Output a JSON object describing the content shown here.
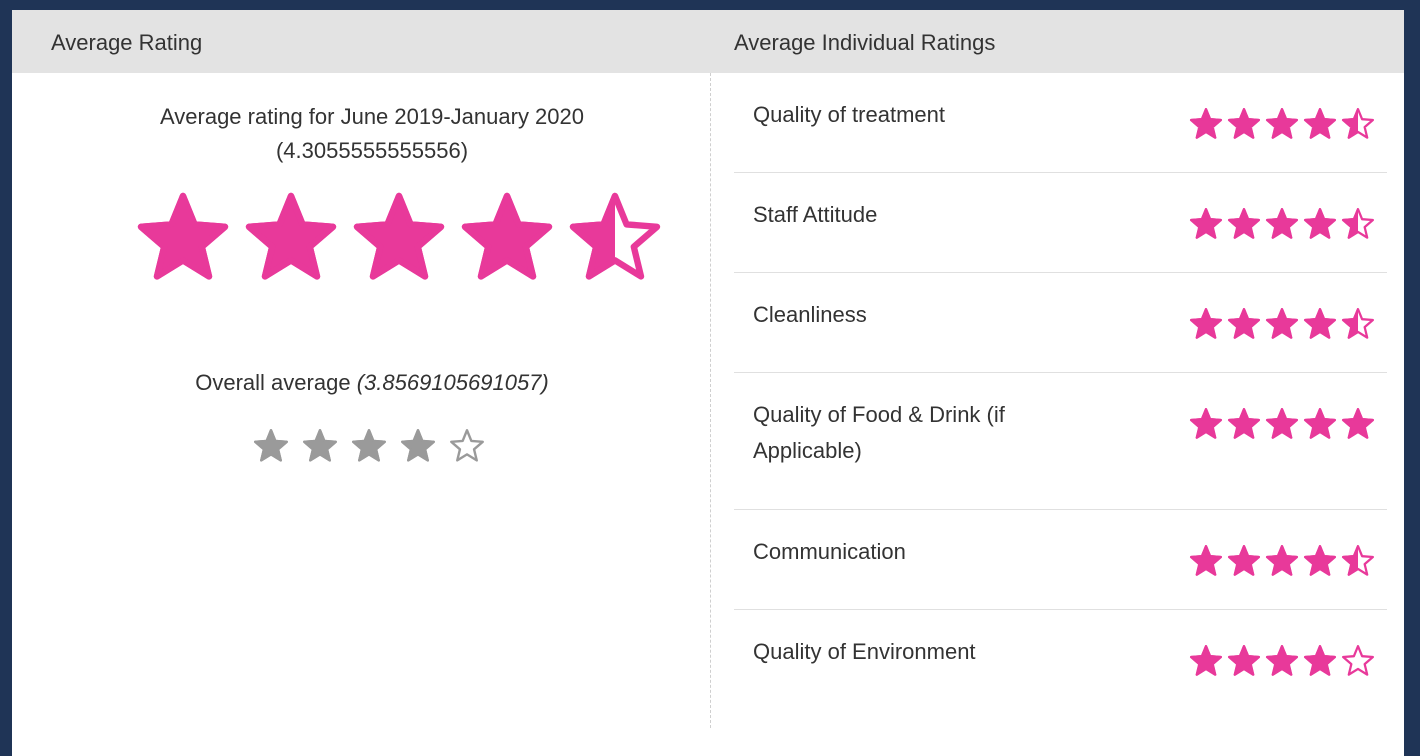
{
  "header": {
    "left_title": "Average Rating",
    "right_title": "Average Individual Ratings"
  },
  "average": {
    "line1": "Average rating for June 2019-January 2020",
    "line2": "(4.3055555555556)",
    "rating": 4.5,
    "color": "#e8399a"
  },
  "overall": {
    "label": "Overall average",
    "value": "(3.8569105691057)",
    "rating": 4,
    "color": "#9a9a9a"
  },
  "ratings": [
    {
      "label": "Quality of treatment",
      "rating": 4.5
    },
    {
      "label": "Staff Attitude",
      "rating": 4.5
    },
    {
      "label": "Cleanliness",
      "rating": 4.5
    },
    {
      "label": "Quality of Food & Drink (if Applicable)",
      "rating": 5
    },
    {
      "label": "Communication",
      "rating": 4.5
    },
    {
      "label": "Quality of Environment",
      "rating": 4
    }
  ],
  "colors": {
    "accent": "#e8399a",
    "grey_star": "#9a9a9a",
    "header_bg": "#e3e3e3",
    "border": "#1f3456"
  }
}
